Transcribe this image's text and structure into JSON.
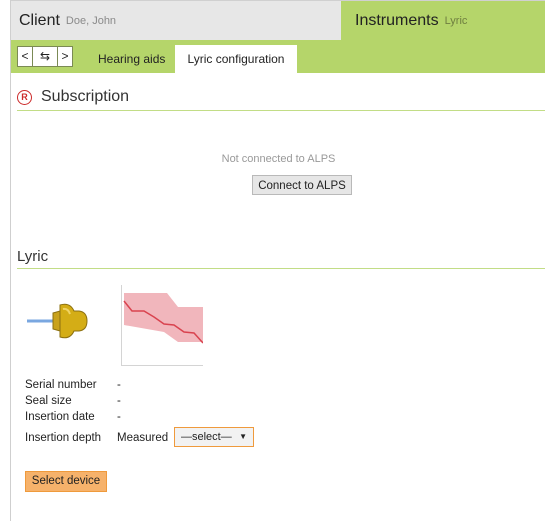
{
  "header": {
    "client_label": "Client",
    "client_name": "Doe, John",
    "instruments_label": "Instruments",
    "instruments_name": "Lyric"
  },
  "nav": {
    "back": "<",
    "swap": "⇆",
    "forward": ">"
  },
  "tabs": [
    {
      "label": "Hearing aids",
      "active": false
    },
    {
      "label": "Lyric configuration",
      "active": true
    }
  ],
  "subscription": {
    "icon": "registered-icon",
    "title": "Subscription",
    "status_text": "Not connected to ALPS",
    "connect_button": "Connect to ALPS"
  },
  "lyric": {
    "title": "Lyric",
    "fields": [
      {
        "label": "Serial number",
        "value": "-"
      },
      {
        "label": "Seal size",
        "value": "-"
      },
      {
        "label": "Insertion date",
        "value": "-"
      },
      {
        "label": "Insertion depth",
        "value": "Measured"
      }
    ],
    "depth_select": "—select—",
    "select_device_button": "Select device"
  },
  "colors": {
    "accent_green": "#b5d56a",
    "header_gray": "#e7e7e7",
    "orange": "#f6b26b",
    "orange_border": "#ef9a3c",
    "red": "#cc2a2a"
  }
}
